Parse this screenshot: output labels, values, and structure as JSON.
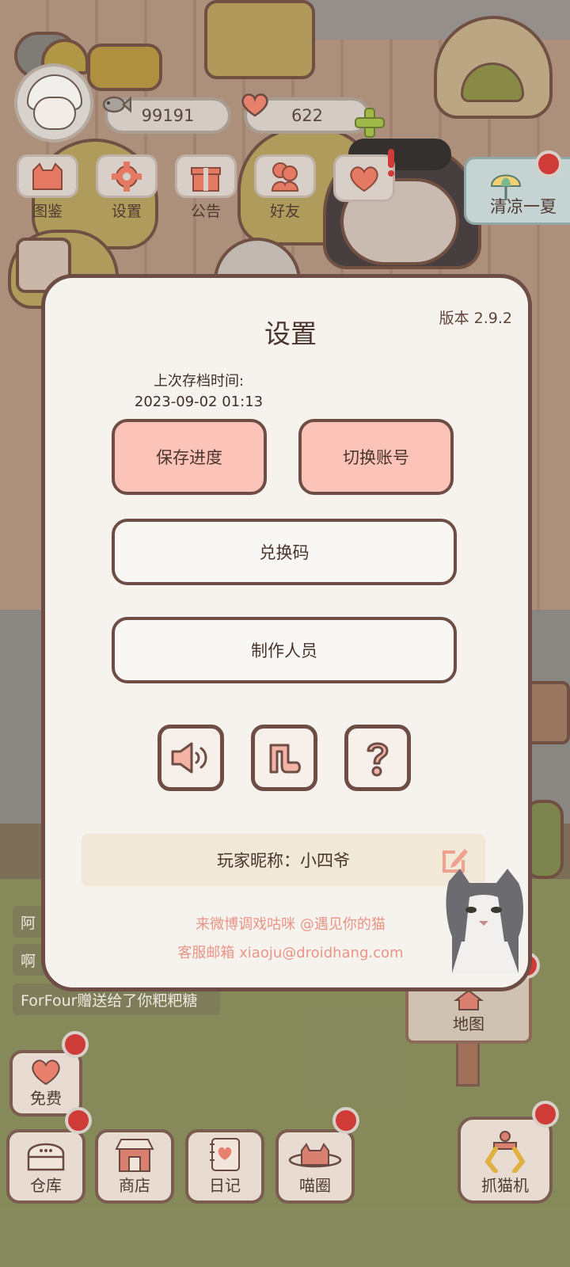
{
  "currency": {
    "fish": "99191",
    "hearts": "622"
  },
  "top_menu": [
    {
      "label": "图鉴"
    },
    {
      "label": "设置"
    },
    {
      "label": "公告"
    },
    {
      "label": "好友"
    }
  ],
  "event": {
    "label": "清凉一夏"
  },
  "feed": [
    {
      "text": "阿"
    },
    {
      "text": "啊"
    },
    {
      "text": "ForFour赠送给了你粑粑糖"
    }
  ],
  "map": {
    "label": "地图"
  },
  "bottom_bar": {
    "free": "免费",
    "warehouse": "仓库",
    "shop": "商店",
    "diary": "日记",
    "circle": "喵圈",
    "claw": "抓猫机"
  },
  "settings": {
    "title": "设置",
    "version": "版本 2.9.2",
    "save_time_label": "上次存档时间:",
    "save_time_value": "2023-09-02 01:13",
    "save_button": "保存进度",
    "switch_button": "切换账号",
    "redeem_button": "兑换码",
    "credits_button": "制作人员",
    "nickname": "玩家昵称：小四爷",
    "weibo": "来微博调戏咕咪 @遇见你的猫",
    "email": "客服邮箱 xiaoju@droidhang.com"
  },
  "colors": {
    "modal_bg": "#f6f3ef",
    "border": "#6e4e44",
    "pink_button": "#fcc3b8",
    "link_text": "#e99584",
    "notification": "#cf3c38"
  }
}
